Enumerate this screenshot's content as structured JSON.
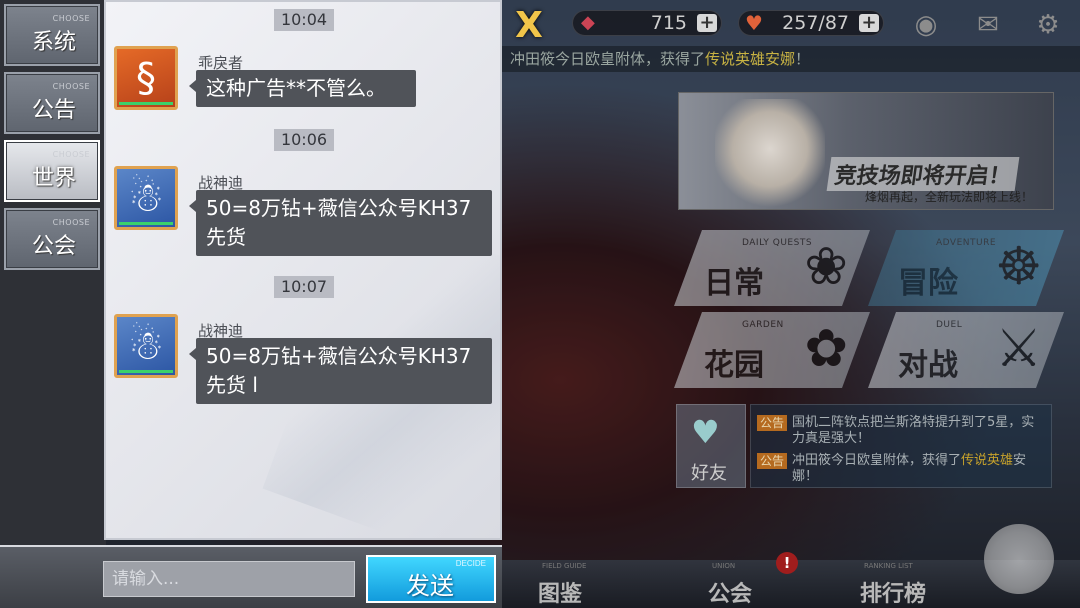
{
  "tabs": [
    {
      "label": "系统",
      "sub": "CHOOSE",
      "active": false
    },
    {
      "label": "公告",
      "sub": "CHOOSE",
      "active": false
    },
    {
      "label": "世界",
      "sub": "CHOOSE",
      "active": true
    },
    {
      "label": "公会",
      "sub": "CHOOSE",
      "active": false
    }
  ],
  "chat": {
    "times": [
      "10:04",
      "10:06",
      "10:07"
    ],
    "messages": [
      {
        "user": "乖戾者",
        "text": "这种广告**不管么。",
        "avatar_icon": "snake-icon"
      },
      {
        "user": "战神迪",
        "text": "50=8万钻+薇信公众号KH37先货",
        "avatar_icon": "yeti-icon"
      },
      {
        "user": "战神迪",
        "text": "50=8万钻+薇信公众号KH37先货 l",
        "avatar_icon": "yeti-icon"
      }
    ]
  },
  "input": {
    "placeholder": "请输入...",
    "value": ""
  },
  "send_button": {
    "label": "发送",
    "sub": "DECIDE"
  },
  "topbar": {
    "close_label": "X",
    "gems": "715",
    "stamina": "257/87"
  },
  "ticker": {
    "prefix": "冲田筱今日欧皇附体，获得了",
    "highlight": "传说英雄安娜",
    "suffix": "！"
  },
  "banner": {
    "title": "竞技场即将开启！",
    "subtitle": "烽烟再起，全新玩法即将上线！"
  },
  "menu": [
    {
      "label": "日常",
      "sub": "DAILY QUESTS"
    },
    {
      "label": "冒险",
      "sub": "ADVENTURE"
    },
    {
      "label": "花园",
      "sub": "GARDEN"
    },
    {
      "label": "对战",
      "sub": "DUEL"
    }
  ],
  "friends_label": "好友",
  "notices": [
    {
      "tag": "公告",
      "text": "国机二阵钦点把兰斯洛特提升到了5星，实力真是强大！"
    },
    {
      "tag": "公告",
      "text_prefix": "冲田筱今日欧皇附体，获得了",
      "highlight": "传说英雄",
      "text_suffix": "安娜！"
    }
  ],
  "bottom_nav": [
    {
      "label": "图鉴",
      "sub": "FIELD GUIDE"
    },
    {
      "label": "公会",
      "sub": "UNION"
    },
    {
      "label": "排行榜",
      "sub": "RANKING LIST"
    }
  ],
  "nav_badge": "!",
  "colors": {
    "send_button": "#1faee8",
    "bubble": "#505359",
    "tab_active": "#ffffff",
    "highlight": "#c7a22b"
  }
}
